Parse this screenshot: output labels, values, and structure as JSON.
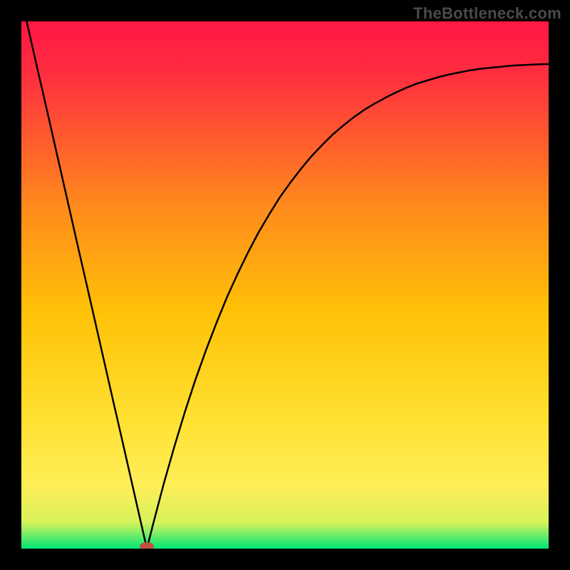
{
  "watermark": "TheBottleneck.com",
  "chart_data": {
    "type": "line",
    "title": "",
    "xlabel": "",
    "ylabel": "",
    "xlim": [
      0,
      1
    ],
    "ylim": [
      0,
      1
    ],
    "background_gradient": {
      "top": "#ff1744",
      "mid": "#ffc107",
      "near_bottom": "#ffee58",
      "bottom": "#00e676"
    },
    "gradient_direction": "vertical",
    "marker": {
      "x": 0.238,
      "y": 0.0,
      "color": "#c0503f",
      "rx": 10,
      "ry": 6
    },
    "series": [
      {
        "name": "curve",
        "color": "#000000",
        "stroke_width": 2.5,
        "x": [
          0.01,
          0.03,
          0.05,
          0.07,
          0.09,
          0.11,
          0.13,
          0.15,
          0.17,
          0.19,
          0.21,
          0.225,
          0.238,
          0.25,
          0.27,
          0.29,
          0.31,
          0.33,
          0.35,
          0.37,
          0.39,
          0.41,
          0.43,
          0.45,
          0.47,
          0.49,
          0.51,
          0.53,
          0.55,
          0.57,
          0.59,
          0.61,
          0.63,
          0.65,
          0.67,
          0.69,
          0.71,
          0.73,
          0.75,
          0.77,
          0.79,
          0.81,
          0.83,
          0.85,
          0.87,
          0.89,
          0.91,
          0.93,
          0.95,
          0.97,
          0.99,
          1.0
        ],
        "y": [
          1.0,
          0.912,
          0.825,
          0.737,
          0.649,
          0.561,
          0.474,
          0.386,
          0.298,
          0.211,
          0.123,
          0.057,
          0.0,
          0.047,
          0.123,
          0.193,
          0.259,
          0.32,
          0.376,
          0.428,
          0.477,
          0.521,
          0.562,
          0.6,
          0.634,
          0.666,
          0.694,
          0.72,
          0.744,
          0.765,
          0.785,
          0.802,
          0.818,
          0.832,
          0.844,
          0.855,
          0.865,
          0.874,
          0.882,
          0.888,
          0.894,
          0.899,
          0.903,
          0.907,
          0.91,
          0.912,
          0.914,
          0.916,
          0.917,
          0.918,
          0.919,
          0.919
        ]
      }
    ]
  }
}
